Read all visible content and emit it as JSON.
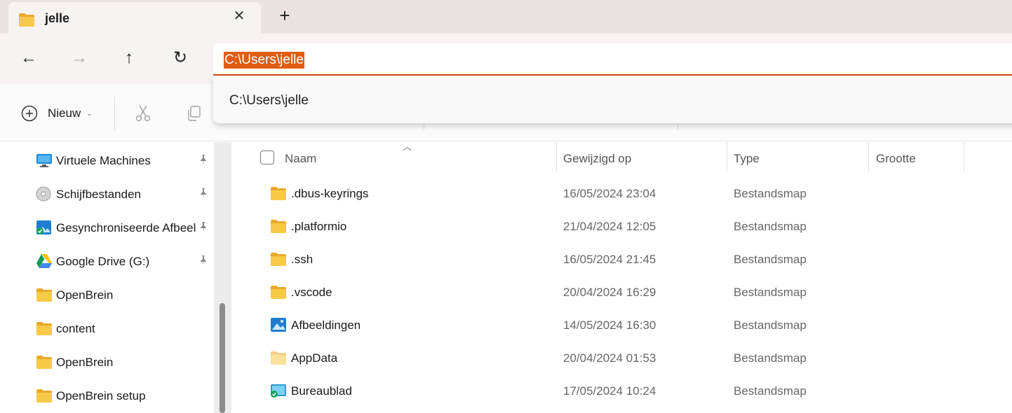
{
  "tab": {
    "title": "jelle",
    "close_label": "✕",
    "new_tab_label": "+"
  },
  "nav": {
    "back": "←",
    "forward": "→",
    "up": "↑",
    "refresh": "↻"
  },
  "address": {
    "value": "C:\\Users\\jelle",
    "suggestion": "C:\\Users\\jelle"
  },
  "toolbar": {
    "new_label": "Nieuw",
    "new_chevron": "⌄"
  },
  "sidebar": {
    "items": [
      {
        "label": "Virtuele Machines",
        "icon": "monitor-icon",
        "pinned": true
      },
      {
        "label": "Schijfbestanden",
        "icon": "disc-icon",
        "pinned": true
      },
      {
        "label": "Gesynchroniseerde Afbeeldingen",
        "icon": "synced-pictures-icon",
        "pinned": true
      },
      {
        "label": "Google Drive (G:)",
        "icon": "google-drive-icon",
        "pinned": true
      },
      {
        "label": "OpenBrein",
        "icon": "folder-icon",
        "pinned": false
      },
      {
        "label": "content",
        "icon": "folder-icon",
        "pinned": false
      },
      {
        "label": "OpenBrein",
        "icon": "folder-icon",
        "pinned": false
      },
      {
        "label": "OpenBrein setup",
        "icon": "folder-icon",
        "pinned": false
      }
    ]
  },
  "columns": {
    "name": "Naam",
    "modified": "Gewijzigd op",
    "type": "Type",
    "size": "Grootte"
  },
  "files": [
    {
      "name": ".dbus-keyrings",
      "modified": "16/05/2024 23:04",
      "type": "Bestandsmap",
      "icon": "folder-icon"
    },
    {
      "name": ".platformio",
      "modified": "21/04/2024 12:05",
      "type": "Bestandsmap",
      "icon": "folder-icon"
    },
    {
      "name": ".ssh",
      "modified": "16/05/2024 21:45",
      "type": "Bestandsmap",
      "icon": "folder-icon"
    },
    {
      "name": ".vscode",
      "modified": "20/04/2024 16:29",
      "type": "Bestandsmap",
      "icon": "folder-icon"
    },
    {
      "name": "Afbeeldingen",
      "modified": "14/05/2024 16:30",
      "type": "Bestandsmap",
      "icon": "pictures-folder-icon"
    },
    {
      "name": "AppData",
      "modified": "20/04/2024 01:53",
      "type": "Bestandsmap",
      "icon": "hidden-folder-icon"
    },
    {
      "name": "Bureaublad",
      "modified": "17/05/2024 10:24",
      "type": "Bestandsmap",
      "icon": "desktop-folder-icon"
    }
  ],
  "colors": {
    "accent": "#e05d10",
    "address_underline": "#c7481a",
    "folder": "#f5c542"
  }
}
